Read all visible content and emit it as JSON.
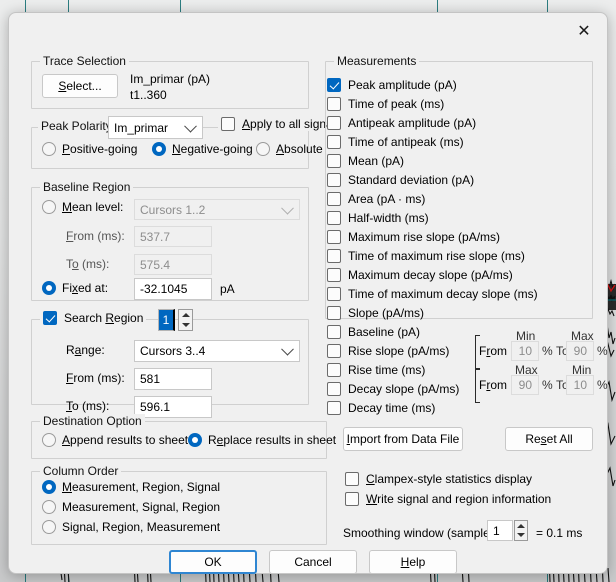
{
  "dialog": {
    "close_icon": "close-icon"
  },
  "trace_selection": {
    "legend": "Trace Selection",
    "select_button": "Select...",
    "signal_name": "Im_primar (pA)",
    "range": "t1..360"
  },
  "peak_polarity": {
    "legend": "Peak Polarity",
    "signal_combo": "Im_primar",
    "apply_all": {
      "label": "Apply to all signals",
      "checked": false
    },
    "options": [
      {
        "label": "Positive-going",
        "selected": false
      },
      {
        "label": "Negative-going",
        "selected": true
      },
      {
        "label": "Absolute",
        "selected": false
      }
    ]
  },
  "baseline_region": {
    "legend": "Baseline Region",
    "mean_level": {
      "label": "Mean level:",
      "selected": false
    },
    "cursors_combo": "Cursors 1..2",
    "from_label": "From (ms):",
    "from_value": "537.7",
    "to_label": "To (ms):",
    "to_value": "575.4",
    "fixed_at": {
      "label": "Fixed at:",
      "selected": true
    },
    "fixed_value": "-32.1045",
    "fixed_units": "pA"
  },
  "search_region": {
    "label": "Search Region",
    "checked": true,
    "spinner_value": "1",
    "range_label": "Range:",
    "range_combo": "Cursors 3..4",
    "from_label": "From (ms):",
    "from_value": "581",
    "to_label": "To (ms):",
    "to_value": "596.1"
  },
  "measurements": {
    "legend": "Measurements",
    "items": [
      {
        "label": "Peak amplitude (pA)",
        "checked": true
      },
      {
        "label": "Time of peak (ms)",
        "checked": false
      },
      {
        "label": "Antipeak amplitude (pA)",
        "checked": false
      },
      {
        "label": "Time of antipeak (ms)",
        "checked": false
      },
      {
        "label": "Mean (pA)",
        "checked": false
      },
      {
        "label": "Standard deviation (pA)",
        "checked": false
      },
      {
        "label": "Area (pA · ms)",
        "checked": false
      },
      {
        "label": "Half-width (ms)",
        "checked": false
      },
      {
        "label": "Maximum rise slope (pA/ms)",
        "checked": false
      },
      {
        "label": "Time of maximum rise slope (ms)",
        "checked": false
      },
      {
        "label": "Maximum decay slope (pA/ms)",
        "checked": false
      },
      {
        "label": "Time of maximum decay slope (ms)",
        "checked": false
      },
      {
        "label": "Slope (pA/ms)",
        "checked": false
      },
      {
        "label": "Baseline (pA)",
        "checked": false
      },
      {
        "label": "Rise slope (pA/ms)",
        "checked": false
      },
      {
        "label": "Rise time (ms)",
        "checked": false
      },
      {
        "label": "Decay slope (pA/ms)",
        "checked": false
      },
      {
        "label": "Decay time (ms)",
        "checked": false
      }
    ],
    "rise_limits": {
      "min_header": "Min",
      "max_header": "Max",
      "from_label": "From",
      "from_value": "10",
      "pct1": "%",
      "to_label": "To",
      "to_value": "90",
      "pct2": "%"
    },
    "decay_limits": {
      "max_header": "Max",
      "min_header": "Min",
      "from_label": "From",
      "from_value": "90",
      "pct1": "%",
      "to_label": "To",
      "to_value": "10",
      "pct2": "%"
    }
  },
  "destination_option": {
    "legend": "Destination Option",
    "options": [
      {
        "label": "Append results to sheet",
        "selected": false
      },
      {
        "label": "Replace results in sheet",
        "selected": true
      }
    ]
  },
  "column_order": {
    "legend": "Column Order",
    "options": [
      {
        "label": "Measurement, Region, Signal",
        "selected": true
      },
      {
        "label": "Measurement, Signal, Region",
        "selected": false
      },
      {
        "label": "Signal, Region, Measurement",
        "selected": false
      }
    ]
  },
  "right_actions": {
    "import_button": "Import from Data File",
    "reset_button": "Reset All",
    "clampex_checkbox": {
      "label": "Clampex-style statistics display",
      "checked": false
    },
    "write_info_checkbox": {
      "label": "Write signal and region information",
      "checked": false
    },
    "smoothing_label": "Smoothing window (samples):",
    "smoothing_value": "1",
    "smoothing_equals": "= 0.1 ms"
  },
  "footer": {
    "ok": "OK",
    "cancel": "Cancel",
    "help": "Help"
  },
  "colors": {
    "accent": "#0067c0",
    "dialog_bg": "#f0f0f0",
    "gridline": "#0b6a6f",
    "trace": "#111111",
    "trace_highlight": "#d01414"
  }
}
